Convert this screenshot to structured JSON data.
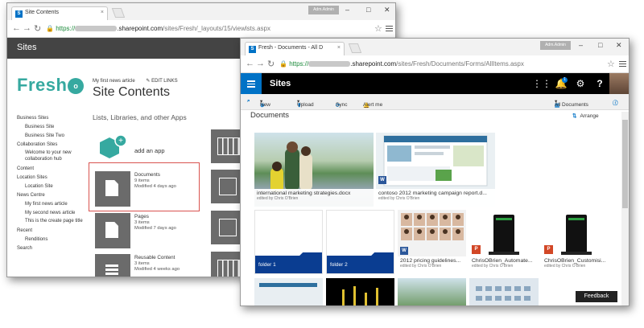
{
  "win1": {
    "tab_title": "Site Contents",
    "user_badge": "Adm.Admin",
    "url": {
      "https": "https://",
      "host": "sharepoint.com",
      "path": "/sites/Fresh/_layouts/15/viewlsts.aspx"
    },
    "suite_title": "Sites",
    "logo": {
      "text": "Fresh",
      "o": "o"
    },
    "topnav": {
      "link": "My first news article",
      "edit": "EDIT LINKS"
    },
    "page_title": "Site Contents",
    "section_title": "Lists, Libraries, and other Apps",
    "add_app_label": "add an app",
    "left_nav": [
      {
        "label": "Business Sites"
      },
      {
        "label": "Business Site"
      },
      {
        "label": "Business Site Two"
      },
      {
        "label": "Collaboration Sites"
      },
      {
        "label": "Welcome to your new collaboration hub"
      },
      {
        "label": "Content"
      },
      {
        "label": "Location Sites"
      },
      {
        "label": "Location Site"
      },
      {
        "label": "News Centre"
      },
      {
        "label": "My first news article"
      },
      {
        "label": "My second news article"
      },
      {
        "label": "This is the create page title"
      },
      {
        "label": "Recent"
      },
      {
        "label": "Renditions"
      },
      {
        "label": "Search"
      }
    ],
    "apps": [
      {
        "name": "Documents",
        "count": "9 items",
        "modified": "Modified 4 days ago"
      },
      {
        "name": "Pages",
        "count": "3 items",
        "modified": "Modified 7 days ago"
      },
      {
        "name": "Reusable Content",
        "count": "3 items",
        "modified": "Modified 4 weeks ago"
      }
    ]
  },
  "win2": {
    "tab_title": "Fresh - Documents - All D",
    "user_badge": "Adm.Admin",
    "url": {
      "https": "https://",
      "host": "sharepoint.com",
      "path": "/sites/Fresh/Documents/Forms/AllItems.aspx"
    },
    "suite_title": "Sites",
    "notification_count": "1",
    "commands": {
      "new": "New",
      "upload": "Upload",
      "sync": "Sync",
      "alert": "Alert me",
      "view": "All Documents"
    },
    "library_title": "Documents",
    "arrange": "Arrange",
    "files": [
      {
        "name": "international marketing strategies.docx",
        "editor": "edited by Chris O'Brien"
      },
      {
        "name": "contoso 2012 marketing campaign report.d...",
        "editor": "edited by Chris O'Brien"
      },
      {
        "name": "2012 pricing guidelines...",
        "editor": "edited by Chris O'Brien"
      },
      {
        "name": "ChrisOBrien_Automate...",
        "editor": "edited by Chris O'Brien"
      },
      {
        "name": "ChrisOBrien_Customisi...",
        "editor": "edited by Chris O'Brien"
      }
    ],
    "folders": [
      {
        "name": "folder 1",
        "count": "0"
      },
      {
        "name": "folder 2",
        "count": "0"
      }
    ],
    "feedback": "Feedback"
  }
}
